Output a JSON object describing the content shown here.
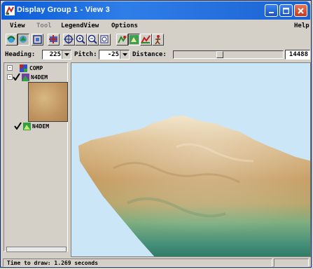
{
  "window": {
    "title": "Display Group 1 - View 3"
  },
  "menu": {
    "items": [
      "View",
      "Tool",
      "LegendView",
      "Options"
    ],
    "help": "Help"
  },
  "toolbar": {
    "icons": [
      "orbit-icon",
      "pan-3d-icon",
      "frame-icon",
      "add-layer-icon",
      "recenter-icon",
      "zoom-in-icon",
      "zoom-out-icon",
      "zoom-box-icon",
      "fly-icon",
      "select-tool-icon",
      "elevation-profile-icon",
      "walk-icon"
    ],
    "active": [
      "pan-3d-icon",
      "select-tool-icon"
    ]
  },
  "controls": {
    "heading_label": "Heading:",
    "heading_value": "225",
    "pitch_label": "Pitch:",
    "pitch_value": "-25",
    "distance_label": "Distance:",
    "distance_value": "14488",
    "distance_slider_fraction": 0.42
  },
  "legend": {
    "group_name": "COMP",
    "layer1": "N4DEM",
    "layer2": "N4DEM",
    "layer1_checked": true,
    "layer2_checked": true
  },
  "status": {
    "text": "Time to draw: 1.269 seconds"
  },
  "colors": {
    "sky": "#cbe6f7",
    "terrain_high": "#e6d0a8",
    "terrain_mid": "#c79a5e",
    "terrain_low": "#3f8c72",
    "title_bar": "#0a5bd8"
  }
}
